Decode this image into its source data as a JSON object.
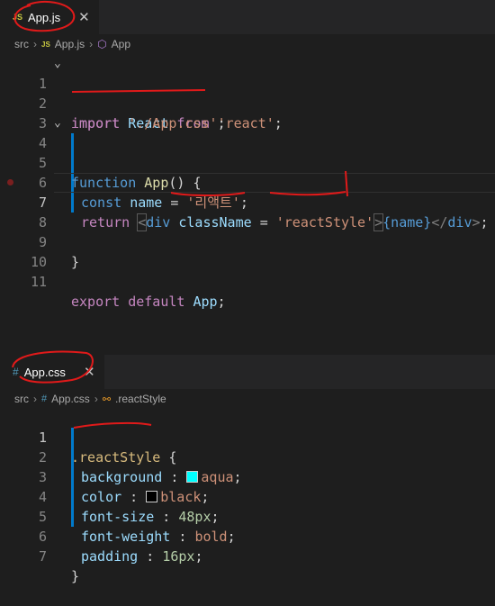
{
  "js_editor": {
    "tab": {
      "lang": "JS",
      "label": "App.js",
      "close": "✕"
    },
    "breadcrumb": {
      "folder": "src",
      "lang": "JS",
      "file": "App.js",
      "symbol": "App"
    },
    "line_numbers": [
      "1",
      "2",
      "3",
      "4",
      "5",
      "6",
      "7",
      "8",
      "9",
      "10",
      "11"
    ],
    "line1": {
      "kw": "import",
      "name": "React",
      "from": "from",
      "str": "'react'",
      "end": ";"
    },
    "line2": {
      "kw": "import",
      "str": "'./App.css'",
      "end": ";"
    },
    "line4": {
      "kw": "function",
      "name": "App",
      "rest": "() {"
    },
    "line6": {
      "kw": "const",
      "var": "name",
      "eq": "=",
      "str": "'리액트'",
      "end": ";"
    },
    "line7": {
      "kw": "return",
      "lt": "<",
      "tag": "div",
      "attr": "className",
      "eq": "=",
      "str": "'reactStyle'",
      "gt": ">",
      "expr": "{name}",
      "close_lt": "</",
      "close_tag": "div",
      "close_gt": ">",
      "end": ";"
    },
    "line9": {
      "brace": "}"
    },
    "line11": {
      "kw1": "export",
      "kw2": "default",
      "name": "App",
      "end": ";"
    }
  },
  "css_editor": {
    "tab": {
      "hash": "#",
      "label": "App.css",
      "close": "✕"
    },
    "breadcrumb": {
      "folder": "src",
      "hash": "#",
      "file": "App.css",
      "symbol": ".reactStyle"
    },
    "line_numbers": [
      "1",
      "2",
      "3",
      "4",
      "5",
      "6",
      "7"
    ],
    "selector": ".reactStyle",
    "open_brace": "{",
    "close_brace": "}",
    "rules": [
      {
        "prop": "background",
        "value": "aqua",
        "swatch": "#00ffff"
      },
      {
        "prop": "color",
        "value": "black",
        "swatch": "#000000"
      },
      {
        "prop": "font-size",
        "value": "48px"
      },
      {
        "prop": "font-weight",
        "value": "bold"
      },
      {
        "prop": "padding",
        "value": "16px"
      }
    ]
  },
  "colors": {
    "background": "#1e1e1e",
    "accent": "#007acc",
    "annotation": "#e01a1a"
  }
}
